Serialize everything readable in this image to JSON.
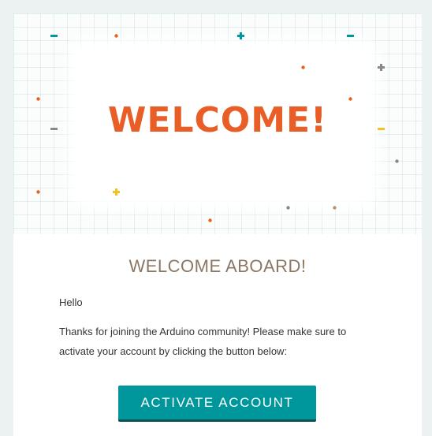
{
  "hero": {
    "title": "WELCOME!"
  },
  "content": {
    "subtitle": "WELCOME ABOARD!",
    "greeting": "Hello",
    "body": "Thanks for joining the Arduino community! Please make sure to activate your account by clicking the button below:"
  },
  "cta": {
    "label": "ACTIVATE ACCOUNT"
  },
  "colors": {
    "page_background": "#ecf1f1",
    "hero_title": "#e95d26",
    "subtitle": "#8c7765",
    "button": "#00979c",
    "deco_teal": "#00979c",
    "deco_orange": "#e8601c",
    "deco_gray": "#888888",
    "deco_yellow": "#f2c220",
    "deco_tan": "#b8916b"
  },
  "decorations": [
    {
      "name": "teal-dash-icon",
      "shape": "dash",
      "color": "deco_teal"
    },
    {
      "name": "orange-dot-icon",
      "shape": "dot",
      "color": "deco_orange"
    },
    {
      "name": "teal-plus-icon",
      "shape": "plus",
      "color": "deco_teal"
    },
    {
      "name": "teal-dash-icon",
      "shape": "dash",
      "color": "deco_teal"
    },
    {
      "name": "gray-plus-icon",
      "shape": "plus",
      "color": "deco_gray"
    },
    {
      "name": "orange-dot-icon",
      "shape": "dot",
      "color": "deco_orange"
    },
    {
      "name": "orange-dot-icon",
      "shape": "dot",
      "color": "deco_orange"
    },
    {
      "name": "orange-dot-icon",
      "shape": "dot",
      "color": "deco_orange"
    },
    {
      "name": "gray-dash-icon",
      "shape": "dash",
      "color": "deco_gray"
    },
    {
      "name": "yellow-dash-icon",
      "shape": "dash",
      "color": "deco_yellow"
    },
    {
      "name": "gray-dot-icon",
      "shape": "dot",
      "color": "deco_gray"
    },
    {
      "name": "orange-dot-icon",
      "shape": "dot",
      "color": "deco_orange"
    },
    {
      "name": "yellow-plus-icon",
      "shape": "plus",
      "color": "deco_yellow"
    },
    {
      "name": "gray-dot-icon",
      "shape": "dot",
      "color": "deco_gray"
    },
    {
      "name": "tan-dot-icon",
      "shape": "dot",
      "color": "deco_tan"
    },
    {
      "name": "orange-dot-icon",
      "shape": "dot",
      "color": "deco_orange"
    }
  ]
}
